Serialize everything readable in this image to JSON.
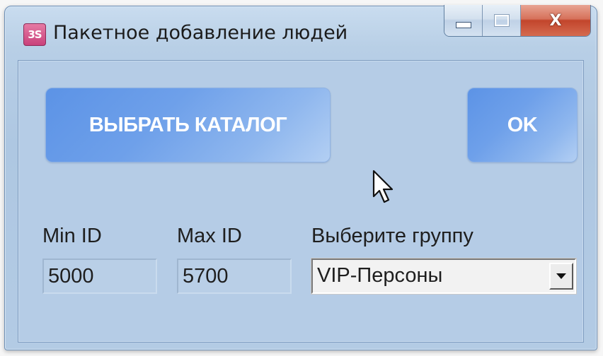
{
  "window": {
    "title": "Пакетное добавление людей",
    "app_icon_text": "3S",
    "close_glyph": "X"
  },
  "buttons": {
    "select_catalog": "ВЫБРАТЬ КАТАЛОГ",
    "ok": "OK"
  },
  "fields": {
    "min_id": {
      "label": "Min ID",
      "value": "5000"
    },
    "max_id": {
      "label": "Max ID",
      "value": "5700"
    },
    "group": {
      "label": "Выберите группу",
      "selected": "VIP-Персоны"
    }
  },
  "icons": {
    "app": "app-icon",
    "minimize": "minimize-icon",
    "maximize": "maximize-icon",
    "close": "close-icon",
    "dropdown": "chevron-down-icon",
    "cursor": "mouse-pointer-icon"
  },
  "colors": {
    "client_background": "#b5cce6",
    "button_blue": "#5c93e6",
    "close_red": "#c2452c",
    "app_icon_pink": "#c9417b"
  }
}
